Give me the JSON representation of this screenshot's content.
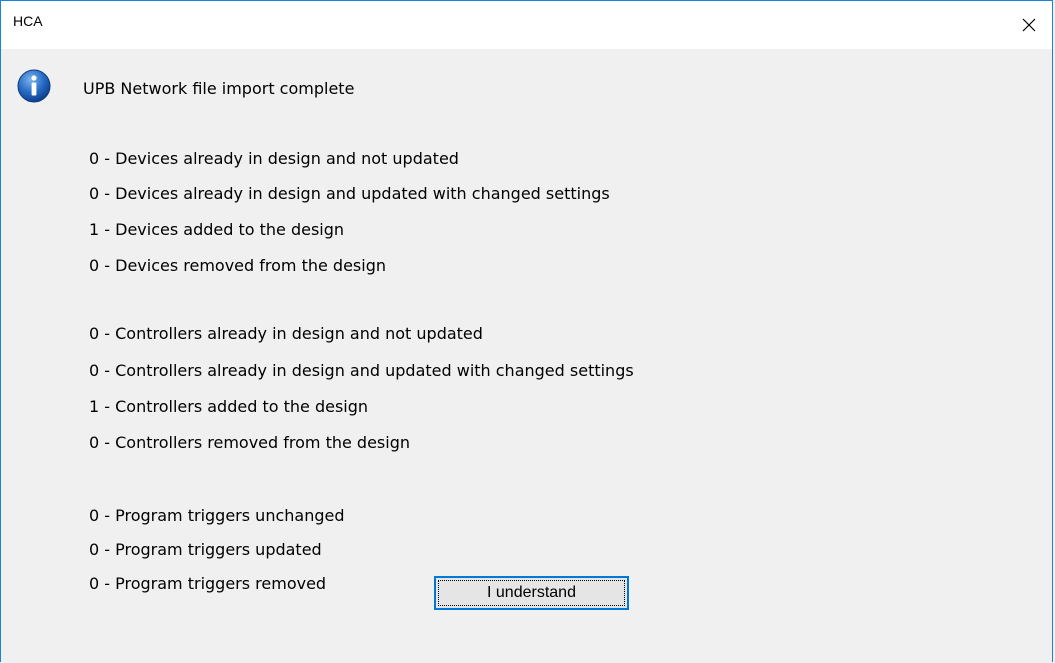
{
  "window": {
    "title": "HCA"
  },
  "dialog": {
    "icon": "info-icon",
    "headline": "UPB Network file import complete",
    "devices": [
      "0 - Devices already in design and not updated",
      "0 - Devices already in design and updated with changed settings",
      "1 - Devices added to the design",
      "0 - Devices removed from the design"
    ],
    "controllers": [
      "0 - Controllers already in design and not updated",
      "0 - Controllers already in design and updated with changed settings",
      "1 - Controllers added to the design",
      "0 - Controllers removed from the design"
    ],
    "triggers": [
      "0 - Program triggers unchanged",
      "0 - Program triggers updated",
      "0 - Program triggers removed"
    ],
    "button_label": "I understand"
  },
  "colors": {
    "window_border": "#1883d7",
    "button_border": "#0078d7",
    "icon_blue": "#1565c0"
  }
}
